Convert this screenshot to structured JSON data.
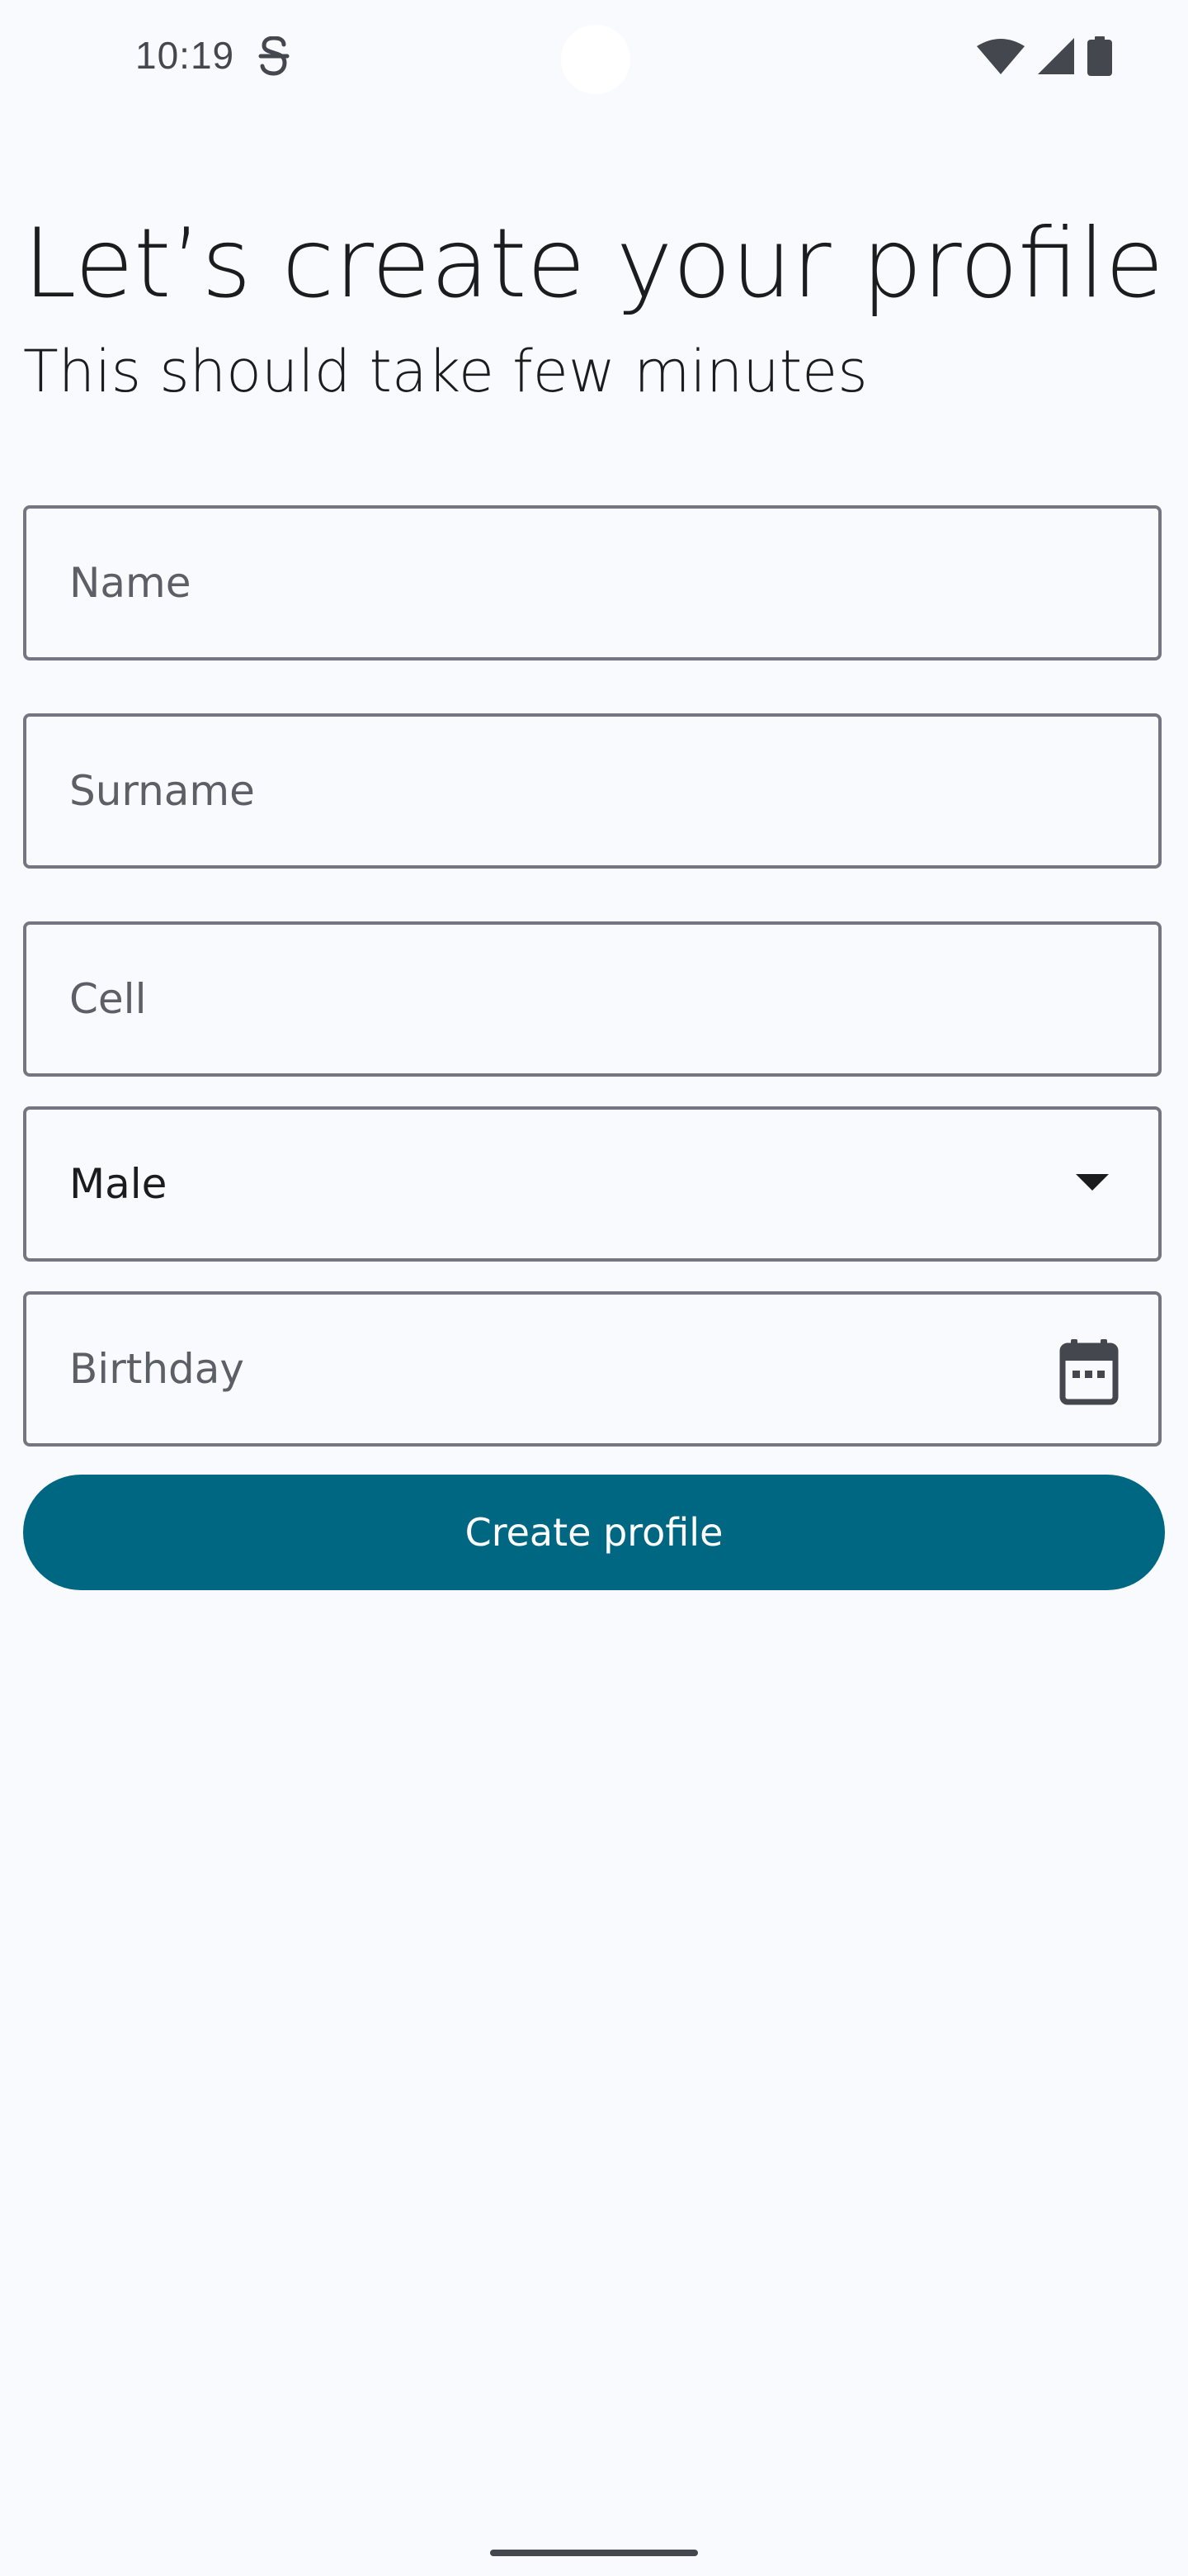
{
  "status_bar": {
    "time": "10:19",
    "sim_icon": "sim-status-icon",
    "wifi_icon": "wifi-icon",
    "signal_icon": "cell-signal-icon",
    "battery_icon": "battery-icon"
  },
  "header": {
    "title": "Let’s create your profile",
    "subtitle": "This should take few minutes"
  },
  "form": {
    "name_placeholder": "Name",
    "name_value": "",
    "surname_placeholder": "Surname",
    "surname_value": "",
    "cell_placeholder": "Cell",
    "cell_value": "",
    "gender_selected": "Male",
    "gender_icon": "chevron-down-icon",
    "birthday_placeholder": "Birthday",
    "birthday_value": "",
    "birthday_icon": "calendar-icon",
    "submit_label": "Create profile"
  },
  "colors": {
    "background": "#f9fafd",
    "primary": "#006783",
    "on_primary": "#ffffff",
    "outline": "#74777f",
    "text": "#1a1c1e",
    "placeholder": "#5c5f66"
  }
}
